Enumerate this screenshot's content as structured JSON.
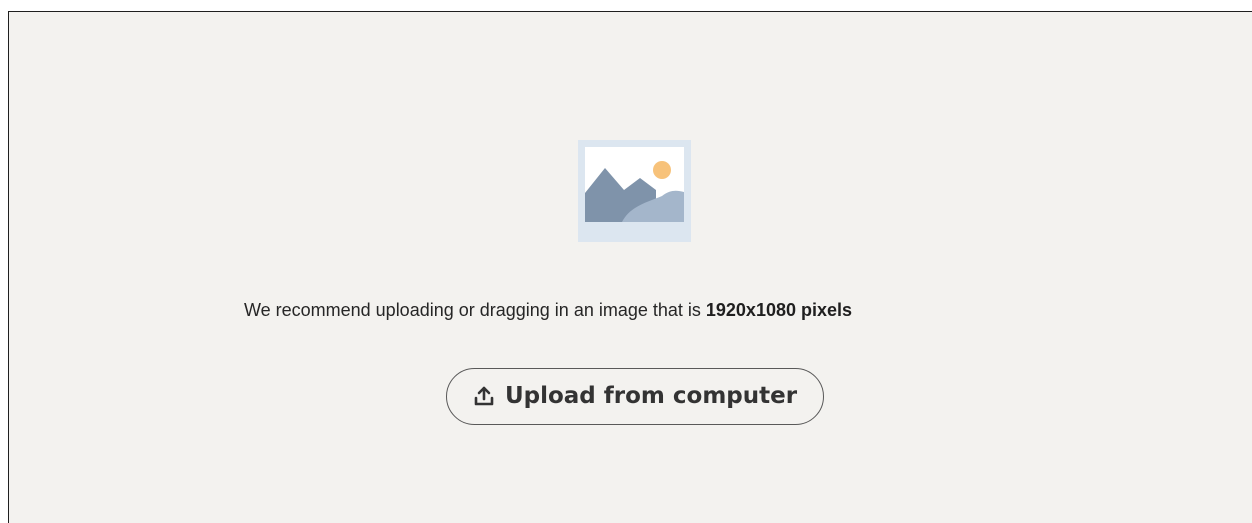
{
  "uploader": {
    "placeholder_icon": "image-placeholder-icon",
    "recommendation_prefix": "We recommend uploading or dragging in an image that is ",
    "recommendation_size": "1920x1080 pixels",
    "upload_button": {
      "icon": "upload-icon",
      "label": "Upload from computer"
    }
  },
  "colors": {
    "panel_background": "#f3f2ef",
    "placeholder_frame": "#dce6f0",
    "mountain_dark": "#7f93aa",
    "mountain_light": "#a4b6cb",
    "sun": "#f7c27a",
    "button_border": "#595959"
  }
}
